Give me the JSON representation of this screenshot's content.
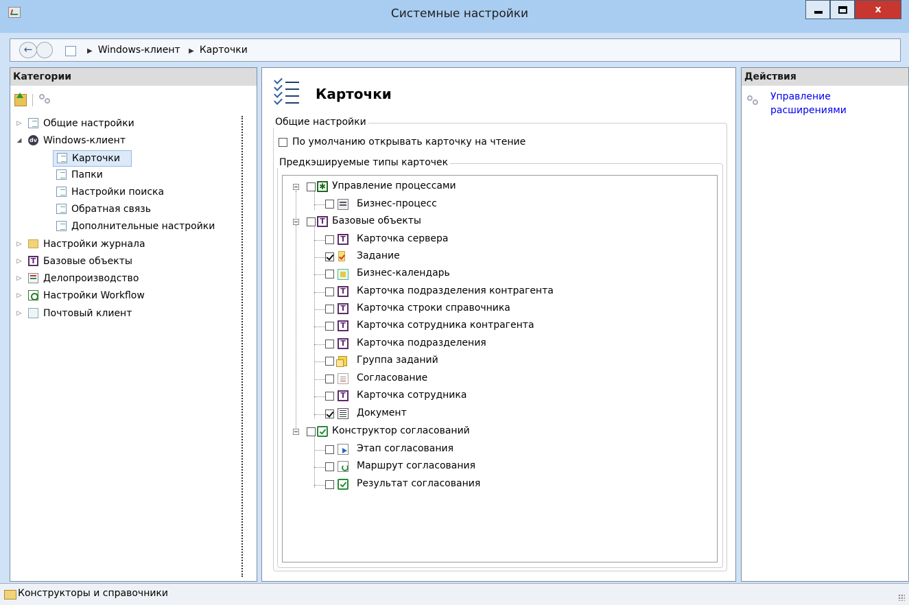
{
  "window": {
    "title": "Системные настройки",
    "close_label": "x"
  },
  "navbar": {
    "back_glyph": "←",
    "breadcrumb": [
      "Windows-клиент",
      "Карточки"
    ]
  },
  "left_panel": {
    "header": "Категории",
    "tree": [
      {
        "label": "Общие настройки",
        "icon": "list-icon",
        "level": 0,
        "toggle": "▷"
      },
      {
        "label": "Windows-клиент",
        "icon": "dv-icon",
        "level": 0,
        "toggle": "◢",
        "expanded": true
      },
      {
        "label": "Карточки",
        "icon": "list-icon",
        "level": 1,
        "selected": true
      },
      {
        "label": "Папки",
        "icon": "list-icon",
        "level": 1
      },
      {
        "label": "Настройки поиска",
        "icon": "list-icon",
        "level": 1
      },
      {
        "label": "Обратная связь",
        "icon": "list-icon",
        "level": 1
      },
      {
        "label": "Дополнительные настройки",
        "icon": "list-icon",
        "level": 1
      },
      {
        "label": "Настройки журнала",
        "icon": "folder-icon",
        "level": 0,
        "toggle": "▷"
      },
      {
        "label": "Базовые объекты",
        "icon": "base-objects-icon",
        "level": 0,
        "toggle": "▷"
      },
      {
        "label": "Делопроизводство",
        "icon": "records-icon",
        "level": 0,
        "toggle": "▷"
      },
      {
        "label": "Настройки Workflow",
        "icon": "workflow-icon",
        "level": 0,
        "toggle": "▷"
      },
      {
        "label": "Почтовый клиент",
        "icon": "mail-icon",
        "level": 0,
        "toggle": "▷"
      }
    ]
  },
  "main": {
    "title": "Карточки",
    "general_group": "Общие настройки",
    "open_readonly_label": "По умолчанию открывать карточку  на чтение",
    "open_readonly_checked": false,
    "precache_group": "Предкэшируемые типы карточек",
    "card_types": [
      {
        "label": "Управление процессами",
        "icon": "process-icon",
        "level": 0,
        "checked": false,
        "group": true
      },
      {
        "label": "Бизнес-процесс",
        "icon": "business-process-icon",
        "level": 1,
        "checked": false
      },
      {
        "label": "Базовые объекты",
        "icon": "base-objects-icon",
        "level": 0,
        "checked": false,
        "group": true
      },
      {
        "label": "Карточка сервера",
        "icon": "base-objects-icon",
        "level": 1,
        "checked": false
      },
      {
        "label": "Задание",
        "icon": "task-icon",
        "level": 1,
        "checked": true
      },
      {
        "label": "Бизнес-календарь",
        "icon": "calendar-icon",
        "level": 1,
        "checked": false
      },
      {
        "label": "Карточка подразделения контрагента",
        "icon": "base-objects-icon",
        "level": 1,
        "checked": false
      },
      {
        "label": "Карточка строки справочника",
        "icon": "base-objects-icon",
        "level": 1,
        "checked": false
      },
      {
        "label": "Карточка сотрудника контрагента",
        "icon": "base-objects-icon",
        "level": 1,
        "checked": false
      },
      {
        "label": "Карточка подразделения",
        "icon": "base-objects-icon",
        "level": 1,
        "checked": false
      },
      {
        "label": "Группа заданий",
        "icon": "task-group-icon",
        "level": 1,
        "checked": false
      },
      {
        "label": "Согласование",
        "icon": "approval-doc-icon",
        "level": 1,
        "checked": false
      },
      {
        "label": "Карточка сотрудника",
        "icon": "base-objects-icon",
        "level": 1,
        "checked": false
      },
      {
        "label": "Документ",
        "icon": "document-icon",
        "level": 1,
        "checked": true
      },
      {
        "label": "Конструктор согласований",
        "icon": "green-check-icon",
        "level": 0,
        "checked": false,
        "group": true
      },
      {
        "label": "Этап согласования",
        "icon": "approval-stage-icon",
        "level": 1,
        "checked": false
      },
      {
        "label": "Маршрут согласования",
        "icon": "approval-route-icon",
        "level": 1,
        "checked": false
      },
      {
        "label": "Результат согласования",
        "icon": "green-check-icon",
        "level": 1,
        "checked": false
      }
    ]
  },
  "right_panel": {
    "header": "Действия",
    "action_line1": "Управление",
    "action_line2": "расширениями"
  },
  "statusbar": {
    "text": "Конструкторы и справочники"
  }
}
